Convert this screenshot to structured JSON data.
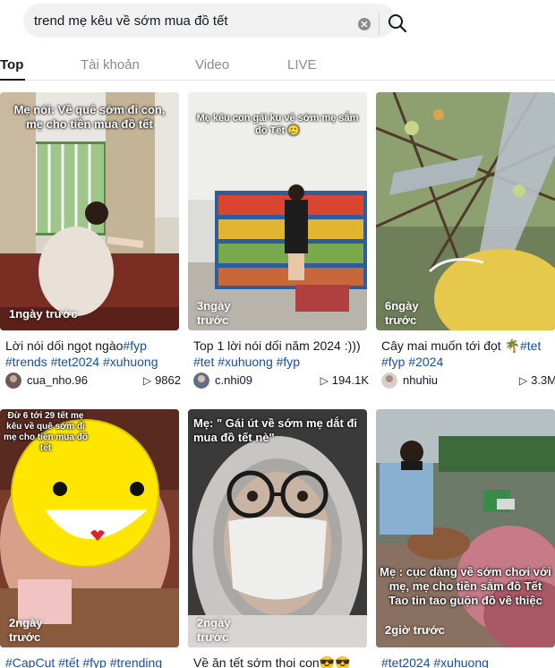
{
  "search": {
    "value": "trend mẹ kêu về sớm mua đồ tết",
    "clear_icon": "close-circle-icon",
    "search_icon": "magnifier-icon"
  },
  "tabs": [
    {
      "label": "Top",
      "active": true
    },
    {
      "label": "Tài khoản",
      "active": false
    },
    {
      "label": "Video",
      "active": false
    },
    {
      "label": "LIVE",
      "active": false
    }
  ],
  "videos": [
    {
      "overlay": "Mẹ nói: Về quê sớm đi con, mẹ cho tiền mua đồ tết",
      "badge": "1ngày trước",
      "caption": "Lời nói dối ngọt ngào",
      "hashtags": "#fyp #trends #tet2024 #xuhuong",
      "username": "cua_nho.96",
      "views": "9862"
    },
    {
      "overlay": "Mẹ kêu con gái ku về sớm mẹ sắm đồ Tết 🥲",
      "badge": "3ngày trước",
      "caption": "Top 1 lời nói dối năm 2024 :)))",
      "hashtags": "#tet #xuhuong #fyp",
      "username": "c.nhi09",
      "views": "194.1K"
    },
    {
      "overlay": "",
      "badge": "6ngày trước",
      "caption": "Cây mai muốn tới đọt 🌴",
      "hashtags": "#tet #fyp #2024",
      "username": "nhuhiu",
      "views": "3.3M"
    },
    {
      "overlay": "Đừ 6 tới 29 tết mẹ kêu về quê sớm đi mẹ cho tiền mua đồ tết",
      "badge": "2ngày trước",
      "caption": "",
      "hashtags": "#CapCut #tết #fyp #trending",
      "username": "",
      "views": ""
    },
    {
      "overlay": "Mẹ: \" Gái út về sớm mẹ dắt đi mua đồ tết nè\"",
      "badge": "2ngày trước",
      "caption": "Về ăn tết sớm thoi con😎😎",
      "hashtags": "",
      "username": "",
      "views": ""
    },
    {
      "overlay": "Mẹ : cục dàng về sớm chơi với mẹ, mẹ cho tiền sắm đồ Tết Tao tin tao guộn đồ về thiệc",
      "badge": "2giờ trước",
      "caption": "",
      "hashtags": "#tet2024 #xuhuong",
      "username": "",
      "views": ""
    }
  ],
  "colors": {
    "hashtag": "#1a4ea0",
    "text": "#161823",
    "muted": "#8a8b91"
  }
}
